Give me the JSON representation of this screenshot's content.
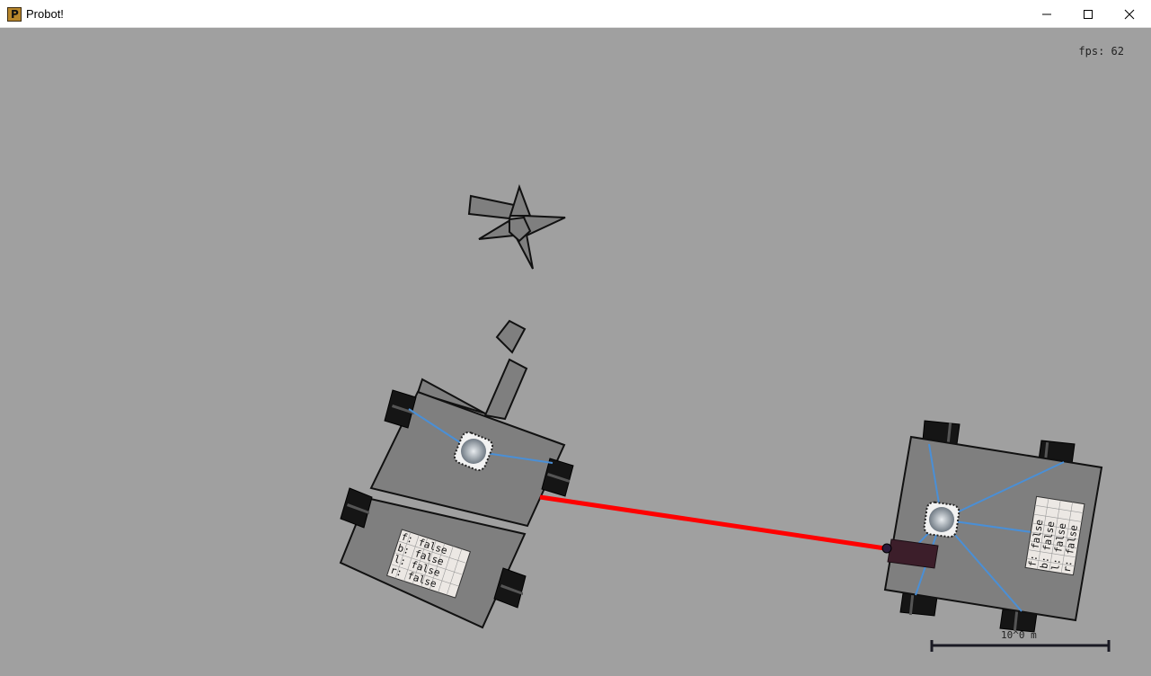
{
  "window": {
    "title": "Probot!",
    "app_icon_letter": "P",
    "controls": [
      "minimize-icon",
      "maximize-icon",
      "close-icon"
    ]
  },
  "hud": {
    "fps_text": "fps: 62",
    "scale_label": "10^0 m"
  },
  "colors": {
    "background": "#a0a0a0",
    "body_fill": "#7f7f7f",
    "wire": "#4a8fd6",
    "laser": "#ff0000",
    "sensor": "#3c1e2a"
  },
  "robot_left": {
    "sensor_grid": [
      {
        "key": "f:",
        "value": "false"
      },
      {
        "key": "b:",
        "value": "false"
      },
      {
        "key": "l:",
        "value": "false"
      },
      {
        "key": "r:",
        "value": "false"
      }
    ]
  },
  "robot_right": {
    "sensor_grid": [
      {
        "key": "f:",
        "value": "false"
      },
      {
        "key": "b:",
        "value": "false"
      },
      {
        "key": "l:",
        "value": "false"
      },
      {
        "key": "r:",
        "value": "false"
      }
    ]
  }
}
